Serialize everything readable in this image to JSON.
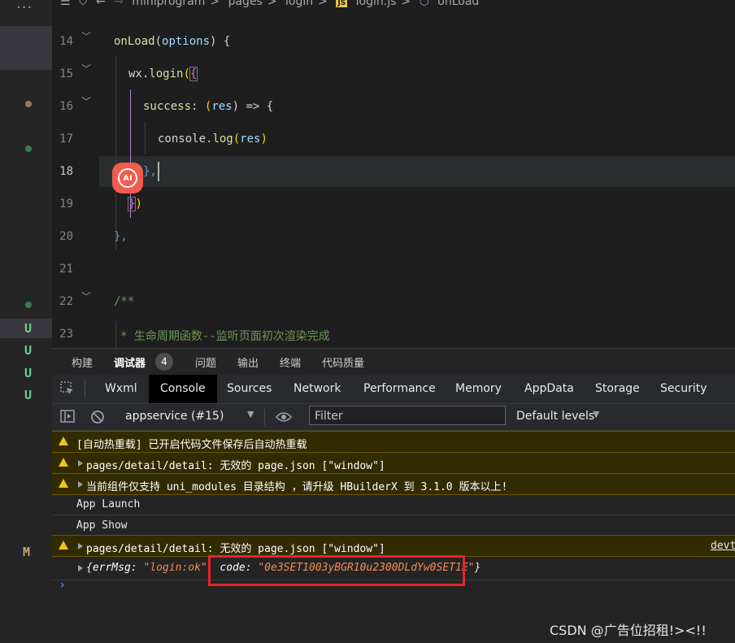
{
  "activity_bar": {
    "ellipsis": "...",
    "badges": [
      "U",
      "U",
      "U",
      "U",
      "M"
    ]
  },
  "breadcrumb": {
    "items": [
      "miniprogram",
      "pages",
      "login",
      "login.js",
      "onLoad"
    ],
    "sep": ">",
    "js_icon": "JS"
  },
  "editor": {
    "line_numbers": [
      "14",
      "15",
      "16",
      "17",
      "18",
      "19",
      "20",
      "21",
      "22",
      "23"
    ],
    "lines": {
      "l14_fn": "onLoad",
      "l14_a": "(",
      "l14_p": "options",
      "l14_b": ") {",
      "l15_a": "wx.",
      "l15_fn": "login",
      "l15_b": "(",
      "l15_c": "{",
      "l16_p": "success",
      "l16_a": ": ",
      "l16_b": "(",
      "l16_c": "res",
      "l16_d": ") => {",
      "l17_a": "console.",
      "l17_fn": "log",
      "l17_b": "(",
      "l17_p": "res",
      "l17_c": ")",
      "l18": "},",
      "l19_a": "}",
      "l19_b": ")",
      "l20": "},",
      "l22": "/**",
      "l23": "* 生命周期函数--监听页面初次渲染完成"
    },
    "ai_badge": "AI"
  },
  "panel_tabs": {
    "items": [
      "构建",
      "调试器",
      "问题",
      "输出",
      "终端",
      "代码质量"
    ],
    "debugger_count": "4"
  },
  "devtools_tabs": [
    "Wxml",
    "Console",
    "Sources",
    "Network",
    "Performance",
    "Memory",
    "AppData",
    "Storage",
    "Security"
  ],
  "toolbar": {
    "context": "appservice (#15)",
    "filter_placeholder": "Filter",
    "levels": "Default levels"
  },
  "console": {
    "r1": "[自动热重载] 已开启代码文件保存后自动热重载",
    "r2": "pages/detail/detail: 无效的 page.json [\"window\"]",
    "r3": "当前组件仅支持 uni_modules 目录结构 ，请升级 HBuilderX 到 3.1.0 版本以上!",
    "r4": "App Launch",
    "r5": "App Show",
    "r6": "pages/detail/detail: 无效的 page.json [\"window\"]",
    "r6_source": "devt",
    "r7": {
      "open": "{",
      "k1": "errMsg",
      "c1": ": ",
      "v1": "\"login:ok\"",
      "sep": ", ",
      "k2": "code",
      "c2": ": ",
      "v2": "\"0e3SET1003yBGR10u2300DLdYw0SET1E\"",
      "close": "}"
    },
    "prompt": "›"
  },
  "watermark": "CSDN @广告位招租!><!!",
  "colors": {
    "accent_red": "#e8232a",
    "warn_yellow": "#f2c31b",
    "ai_badge": "#f25b4d"
  }
}
